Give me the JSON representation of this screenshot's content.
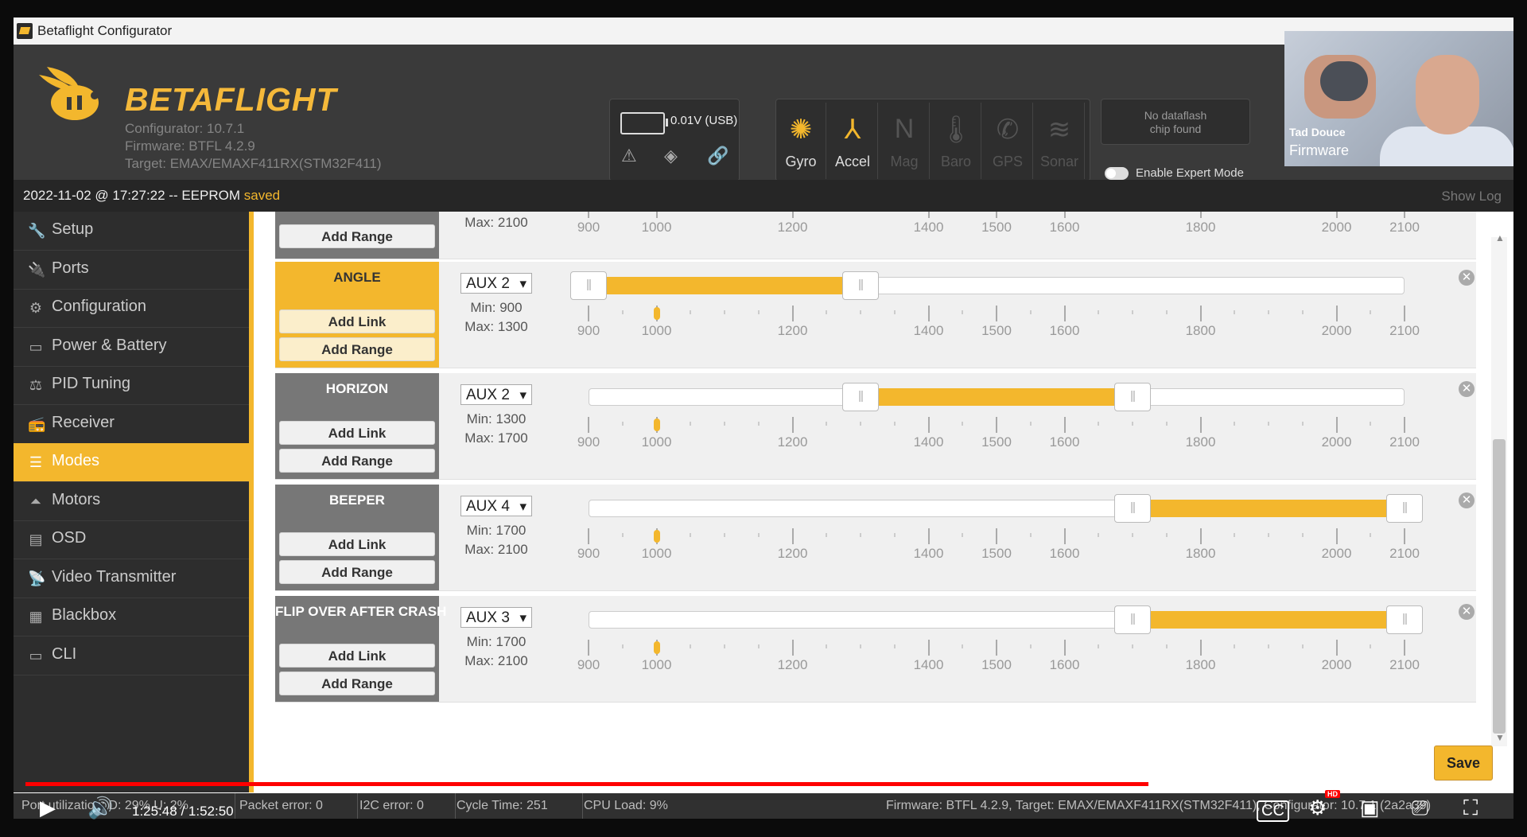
{
  "window": {
    "title": "Betaflight Configurator"
  },
  "header": {
    "logo_text": "BETAFLIGHT",
    "configurator_version": "Configurator: 10.7.1",
    "firmware": "Firmware: BTFL 4.2.9",
    "target": "Target: EMAX/EMAXF411RX(STM32F411)",
    "battery_voltage": "0.01V (USB)",
    "sensors": [
      {
        "label": "Gyro",
        "icon": "gyro-icon",
        "active": true
      },
      {
        "label": "Accel",
        "icon": "accel-icon",
        "active": true
      },
      {
        "label": "Mag",
        "icon": "mag-icon",
        "active": false
      },
      {
        "label": "Baro",
        "icon": "baro-icon",
        "active": false
      },
      {
        "label": "GPS",
        "icon": "gps-icon",
        "active": false
      },
      {
        "label": "Sonar",
        "icon": "sonar-icon",
        "active": false
      }
    ],
    "dataflash_line1": "No dataflash",
    "dataflash_line2": "chip found",
    "expert_mode_label": "Enable Expert Mode"
  },
  "webcam": {
    "name": "Tad Douce",
    "overlay_text": "Firmware"
  },
  "status_top": {
    "timestamp_text": "2022-11-02 @ 17:27:22 -- EEPROM",
    "saved_text": "saved",
    "show_log": "Show Log"
  },
  "sidebar": {
    "items": [
      {
        "label": "Setup",
        "icon": "wrench-icon"
      },
      {
        "label": "Ports",
        "icon": "plug-icon"
      },
      {
        "label": "Configuration",
        "icon": "gear-icon"
      },
      {
        "label": "Power & Battery",
        "icon": "battery-icon"
      },
      {
        "label": "PID Tuning",
        "icon": "pid-icon"
      },
      {
        "label": "Receiver",
        "icon": "receiver-icon"
      },
      {
        "label": "Modes",
        "icon": "toggle-icon",
        "active": true
      },
      {
        "label": "Motors",
        "icon": "motor-icon"
      },
      {
        "label": "OSD",
        "icon": "osd-icon"
      },
      {
        "label": "Video Transmitter",
        "icon": "antenna-icon"
      },
      {
        "label": "Blackbox",
        "icon": "blackbox-icon"
      },
      {
        "label": "CLI",
        "icon": "terminal-icon"
      }
    ]
  },
  "modes": {
    "tick_labels": [
      "900",
      "1000",
      "1200",
      "1400",
      "1500",
      "1600",
      "1800",
      "2000",
      "2100"
    ],
    "add_link": "Add Link",
    "add_range": "Add Range",
    "partial_row": {
      "max": "Max: 2100",
      "add_range": "Add Range"
    },
    "rows": [
      {
        "name": "ANGLE",
        "active": true,
        "aux": "AUX 2",
        "min": "Min: 900",
        "max": "Max: 1300",
        "range": [
          900,
          1300
        ],
        "channel_value": 1000
      },
      {
        "name": "HORIZON",
        "active": false,
        "aux": "AUX 2",
        "min": "Min: 1300",
        "max": "Max: 1700",
        "range": [
          1300,
          1700
        ],
        "channel_value": 1000
      },
      {
        "name": "BEEPER",
        "active": false,
        "aux": "AUX 4",
        "min": "Min: 1700",
        "max": "Max: 2100",
        "range": [
          1700,
          2100
        ],
        "channel_value": 1000
      },
      {
        "name": "FLIP OVER AFTER CRASH",
        "active": false,
        "aux": "AUX 3",
        "min": "Min: 1700",
        "max": "Max: 2100",
        "range": [
          1700,
          2100
        ],
        "channel_value": 1000
      }
    ],
    "save_label": "Save"
  },
  "status_bottom": {
    "port_util": "Port utilization: D: 29% U: 2%",
    "packet_error": "Packet error: 0",
    "i2c_error": "I2C error: 0",
    "cycle_time": "Cycle Time: 251",
    "cpu_load": "CPU Load: 9%",
    "firmware_info": "Firmware: BTFL 4.2.9, Target: EMAX/EMAXF411RX(STM32F411), Configurator: 10.7.1 (2a2a39)"
  },
  "player": {
    "time": "1:25:48 / 1:52:50",
    "progress": 0.76,
    "hd_badge": "HD"
  },
  "colors": {
    "accent": "#f3b72d",
    "header": "#3a3a3a",
    "sidebar": "#2d2d2d"
  }
}
